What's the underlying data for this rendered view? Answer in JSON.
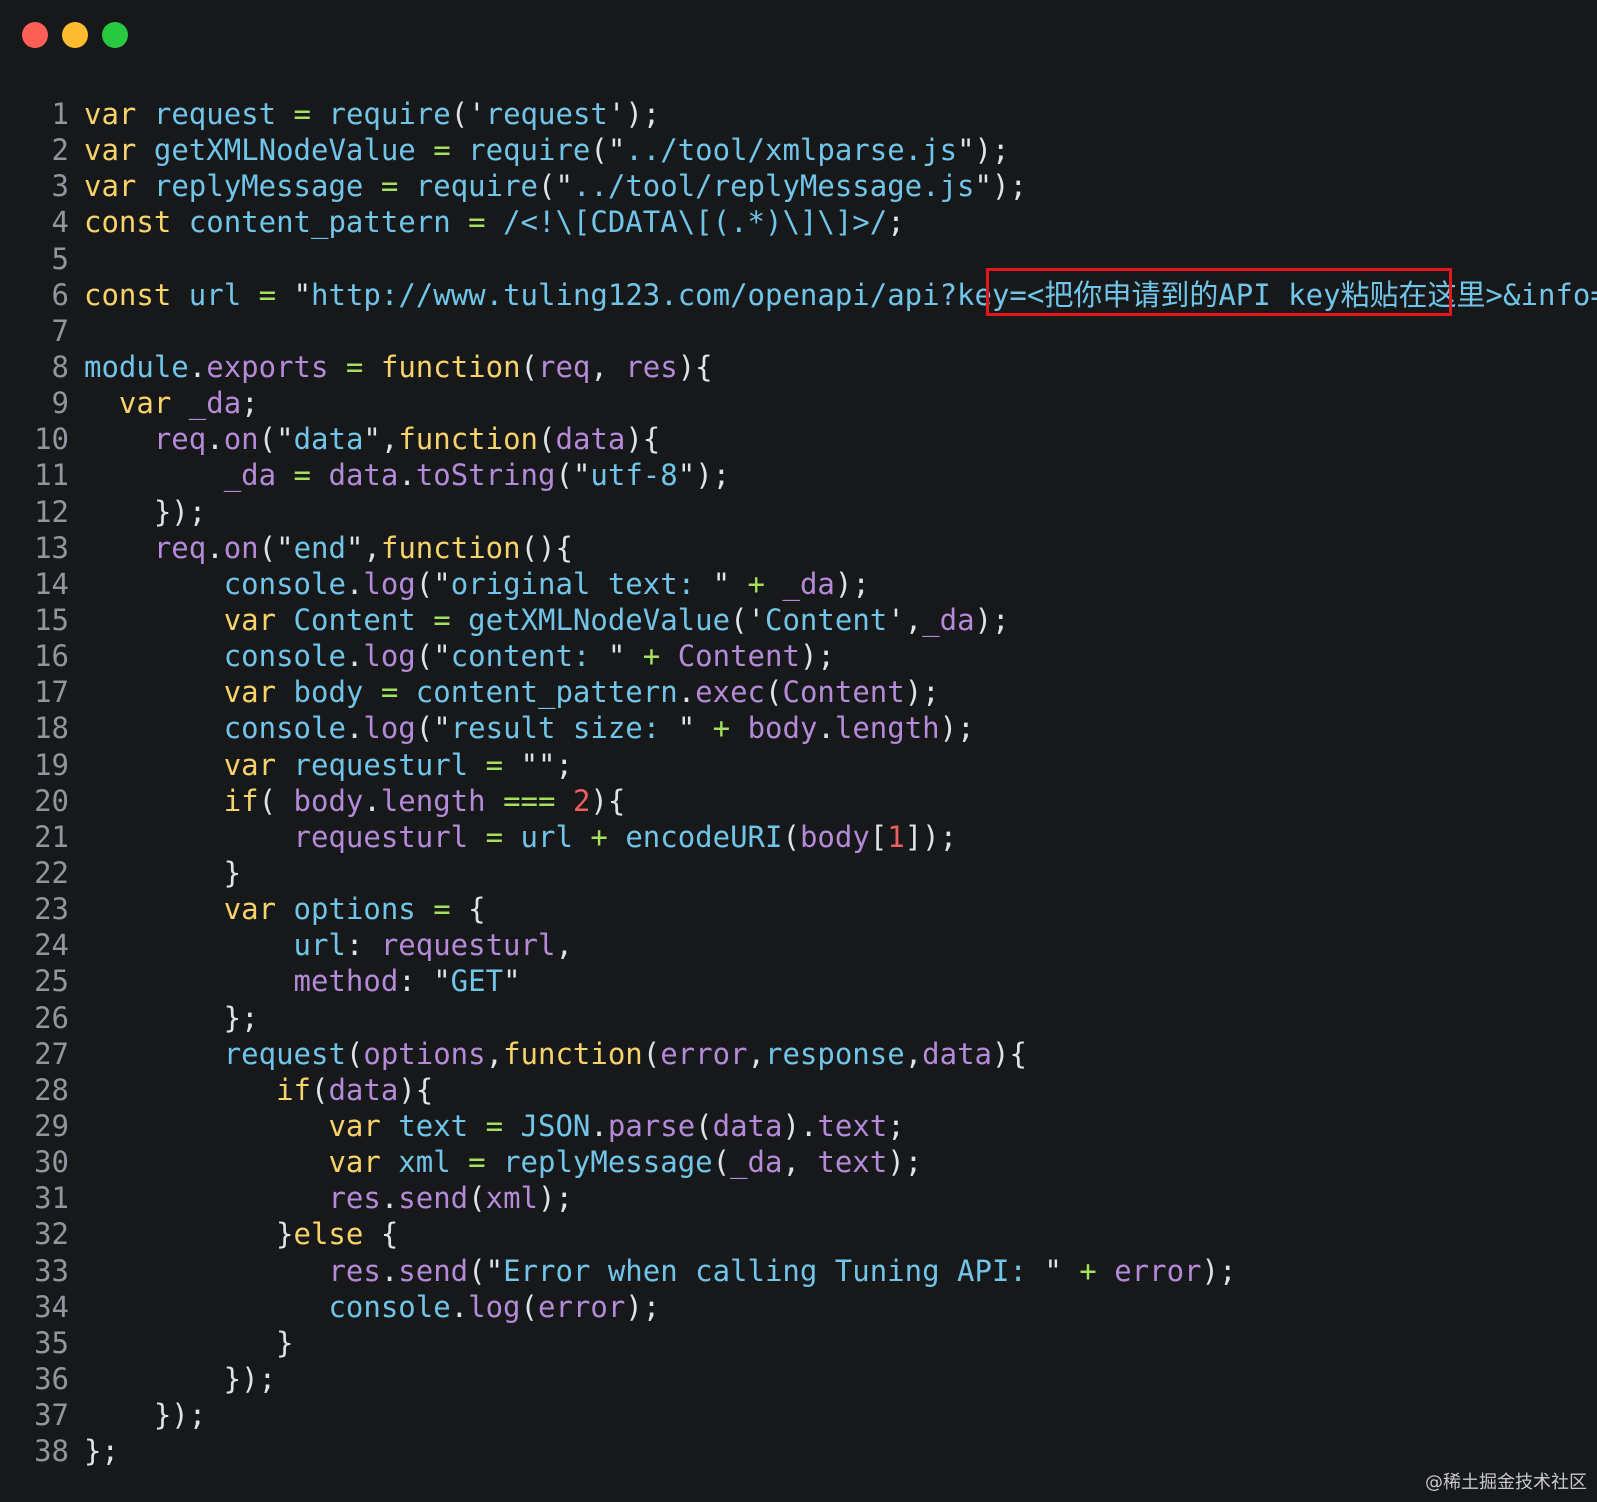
{
  "window": {
    "buttons": [
      "close",
      "minimize",
      "zoom"
    ]
  },
  "code_lines": [
    {
      "n": "1",
      "code": [
        [
          "kw",
          "var"
        ],
        [
          "pu",
          " "
        ],
        [
          "id",
          "request"
        ],
        [
          "pu",
          " "
        ],
        [
          "op",
          "="
        ],
        [
          "pu",
          " "
        ],
        [
          "id",
          "require"
        ],
        [
          "pu",
          "("
        ],
        [
          "st",
          "'"
        ],
        [
          "sv",
          "request"
        ],
        [
          "st",
          "'"
        ],
        [
          "pu",
          ");"
        ]
      ]
    },
    {
      "n": "2",
      "code": [
        [
          "kw",
          "var"
        ],
        [
          "pu",
          " "
        ],
        [
          "id",
          "getXMLNodeValue"
        ],
        [
          "pu",
          " "
        ],
        [
          "op",
          "="
        ],
        [
          "pu",
          " "
        ],
        [
          "id",
          "require"
        ],
        [
          "pu",
          "("
        ],
        [
          "st",
          "\""
        ],
        [
          "sv",
          "../tool/xmlparse.js"
        ],
        [
          "st",
          "\""
        ],
        [
          "pu",
          ");"
        ]
      ]
    },
    {
      "n": "3",
      "code": [
        [
          "kw",
          "var"
        ],
        [
          "pu",
          " "
        ],
        [
          "id",
          "replyMessage"
        ],
        [
          "pu",
          " "
        ],
        [
          "op",
          "="
        ],
        [
          "pu",
          " "
        ],
        [
          "id",
          "require"
        ],
        [
          "pu",
          "("
        ],
        [
          "st",
          "\""
        ],
        [
          "sv",
          "../tool/replyMessage.js"
        ],
        [
          "st",
          "\""
        ],
        [
          "pu",
          ");"
        ]
      ]
    },
    {
      "n": "4",
      "code": [
        [
          "kw",
          "const"
        ],
        [
          "pu",
          " "
        ],
        [
          "id",
          "content_pattern"
        ],
        [
          "pu",
          " "
        ],
        [
          "op",
          "="
        ],
        [
          "pu",
          " "
        ],
        [
          "sv",
          "/<!\\[CDATA\\[(.*)\\]\\]>/"
        ],
        [
          "pu",
          ";"
        ]
      ]
    },
    {
      "n": "5",
      "code": []
    },
    {
      "n": "6",
      "code": [
        [
          "kw",
          "const"
        ],
        [
          "pu",
          " "
        ],
        [
          "id",
          "url"
        ],
        [
          "pu",
          " "
        ],
        [
          "op",
          "="
        ],
        [
          "pu",
          " "
        ],
        [
          "st",
          "\""
        ],
        [
          "sv",
          "http://www.tuling123.com/openapi/api?key=<把你申请到的API key粘贴在这里>&info="
        ],
        [
          "st",
          "\""
        ],
        [
          "pu",
          ";"
        ]
      ]
    },
    {
      "n": "7",
      "code": []
    },
    {
      "n": "8",
      "code": [
        [
          "id",
          "module"
        ],
        [
          "pu",
          "."
        ],
        [
          "pr",
          "exports"
        ],
        [
          "pu",
          " "
        ],
        [
          "op",
          "="
        ],
        [
          "pu",
          " "
        ],
        [
          "kw",
          "function"
        ],
        [
          "pu",
          "("
        ],
        [
          "pr",
          "req"
        ],
        [
          "pu",
          ", "
        ],
        [
          "pr",
          "res"
        ],
        [
          "pu",
          "){"
        ]
      ]
    },
    {
      "n": "9",
      "code": [
        [
          "pu",
          "  "
        ],
        [
          "kw",
          "var"
        ],
        [
          "pu",
          " "
        ],
        [
          "pr",
          "_da"
        ],
        [
          "pu",
          ";"
        ]
      ]
    },
    {
      "n": "10",
      "code": [
        [
          "pu",
          "    "
        ],
        [
          "pr",
          "req"
        ],
        [
          "pu",
          "."
        ],
        [
          "pr",
          "on"
        ],
        [
          "pu",
          "("
        ],
        [
          "st",
          "\""
        ],
        [
          "sv",
          "data"
        ],
        [
          "st",
          "\""
        ],
        [
          "pu",
          ","
        ],
        [
          "kw",
          "function"
        ],
        [
          "pu",
          "("
        ],
        [
          "pr",
          "data"
        ],
        [
          "pu",
          "){"
        ]
      ]
    },
    {
      "n": "11",
      "code": [
        [
          "pu",
          "        "
        ],
        [
          "pr",
          "_da"
        ],
        [
          "pu",
          " "
        ],
        [
          "op",
          "="
        ],
        [
          "pu",
          " "
        ],
        [
          "pr",
          "data"
        ],
        [
          "pu",
          "."
        ],
        [
          "pr",
          "toString"
        ],
        [
          "pu",
          "("
        ],
        [
          "st",
          "\""
        ],
        [
          "sv",
          "utf-8"
        ],
        [
          "st",
          "\""
        ],
        [
          "pu",
          ");"
        ]
      ]
    },
    {
      "n": "12",
      "code": [
        [
          "pu",
          "    });"
        ]
      ]
    },
    {
      "n": "13",
      "code": [
        [
          "pu",
          "    "
        ],
        [
          "pr",
          "req"
        ],
        [
          "pu",
          "."
        ],
        [
          "pr",
          "on"
        ],
        [
          "pu",
          "("
        ],
        [
          "st",
          "\""
        ],
        [
          "sv",
          "end"
        ],
        [
          "st",
          "\""
        ],
        [
          "pu",
          ","
        ],
        [
          "kw",
          "function"
        ],
        [
          "pu",
          "(){"
        ]
      ]
    },
    {
      "n": "14",
      "code": [
        [
          "pu",
          "        "
        ],
        [
          "id",
          "console"
        ],
        [
          "pu",
          "."
        ],
        [
          "pr",
          "log"
        ],
        [
          "pu",
          "("
        ],
        [
          "st",
          "\""
        ],
        [
          "sv",
          "original text: "
        ],
        [
          "st",
          "\""
        ],
        [
          "pu",
          " "
        ],
        [
          "op",
          "+"
        ],
        [
          "pu",
          " "
        ],
        [
          "pr",
          "_da"
        ],
        [
          "pu",
          ");"
        ]
      ]
    },
    {
      "n": "15",
      "code": [
        [
          "pu",
          "        "
        ],
        [
          "kw",
          "var"
        ],
        [
          "pu",
          " "
        ],
        [
          "id",
          "Content"
        ],
        [
          "pu",
          " "
        ],
        [
          "op",
          "="
        ],
        [
          "pu",
          " "
        ],
        [
          "id",
          "getXMLNodeValue"
        ],
        [
          "pu",
          "("
        ],
        [
          "st",
          "'"
        ],
        [
          "sv",
          "Content"
        ],
        [
          "st",
          "'"
        ],
        [
          "pu",
          ","
        ],
        [
          "pr",
          "_da"
        ],
        [
          "pu",
          ");"
        ]
      ]
    },
    {
      "n": "16",
      "code": [
        [
          "pu",
          "        "
        ],
        [
          "id",
          "console"
        ],
        [
          "pu",
          "."
        ],
        [
          "pr",
          "log"
        ],
        [
          "pu",
          "("
        ],
        [
          "st",
          "\""
        ],
        [
          "sv",
          "content: "
        ],
        [
          "st",
          "\""
        ],
        [
          "pu",
          " "
        ],
        [
          "op",
          "+"
        ],
        [
          "pu",
          " "
        ],
        [
          "pr",
          "Content"
        ],
        [
          "pu",
          ");"
        ]
      ]
    },
    {
      "n": "17",
      "code": [
        [
          "pu",
          "        "
        ],
        [
          "kw",
          "var"
        ],
        [
          "pu",
          " "
        ],
        [
          "id",
          "body"
        ],
        [
          "pu",
          " "
        ],
        [
          "op",
          "="
        ],
        [
          "pu",
          " "
        ],
        [
          "id",
          "content_pattern"
        ],
        [
          "pu",
          "."
        ],
        [
          "pr",
          "exec"
        ],
        [
          "pu",
          "("
        ],
        [
          "pr",
          "Content"
        ],
        [
          "pu",
          ");"
        ]
      ]
    },
    {
      "n": "18",
      "code": [
        [
          "pu",
          "        "
        ],
        [
          "id",
          "console"
        ],
        [
          "pu",
          "."
        ],
        [
          "pr",
          "log"
        ],
        [
          "pu",
          "("
        ],
        [
          "st",
          "\""
        ],
        [
          "sv",
          "result size: "
        ],
        [
          "st",
          "\""
        ],
        [
          "pu",
          " "
        ],
        [
          "op",
          "+"
        ],
        [
          "pu",
          " "
        ],
        [
          "pr",
          "body"
        ],
        [
          "pu",
          "."
        ],
        [
          "pr",
          "length"
        ],
        [
          "pu",
          ");"
        ]
      ]
    },
    {
      "n": "19",
      "code": [
        [
          "pu",
          "        "
        ],
        [
          "kw",
          "var"
        ],
        [
          "pu",
          " "
        ],
        [
          "id",
          "requesturl"
        ],
        [
          "pu",
          " "
        ],
        [
          "op",
          "="
        ],
        [
          "pu",
          " "
        ],
        [
          "st",
          "\"\""
        ],
        [
          "pu",
          ";"
        ]
      ]
    },
    {
      "n": "20",
      "code": [
        [
          "pu",
          "        "
        ],
        [
          "kw",
          "if"
        ],
        [
          "pu",
          "( "
        ],
        [
          "pr",
          "body"
        ],
        [
          "pu",
          "."
        ],
        [
          "pr",
          "length"
        ],
        [
          "pu",
          " "
        ],
        [
          "op",
          "==="
        ],
        [
          "pu",
          " "
        ],
        [
          "nu",
          "2"
        ],
        [
          "pu",
          "){"
        ]
      ]
    },
    {
      "n": "21",
      "code": [
        [
          "pu",
          "            "
        ],
        [
          "pr",
          "requesturl"
        ],
        [
          "pu",
          " "
        ],
        [
          "op",
          "="
        ],
        [
          "pu",
          " "
        ],
        [
          "id",
          "url"
        ],
        [
          "pu",
          " "
        ],
        [
          "op",
          "+"
        ],
        [
          "pu",
          " "
        ],
        [
          "id",
          "encodeURI"
        ],
        [
          "pu",
          "("
        ],
        [
          "pr",
          "body"
        ],
        [
          "pu",
          "["
        ],
        [
          "nu",
          "1"
        ],
        [
          "pu",
          "]);"
        ]
      ]
    },
    {
      "n": "22",
      "code": [
        [
          "pu",
          "        }"
        ]
      ]
    },
    {
      "n": "23",
      "code": [
        [
          "pu",
          "        "
        ],
        [
          "kw",
          "var"
        ],
        [
          "pu",
          " "
        ],
        [
          "id",
          "options"
        ],
        [
          "pu",
          " "
        ],
        [
          "op",
          "="
        ],
        [
          "pu",
          " {"
        ]
      ]
    },
    {
      "n": "24",
      "code": [
        [
          "pu",
          "            "
        ],
        [
          "id",
          "url"
        ],
        [
          "pu",
          ": "
        ],
        [
          "pr",
          "requesturl"
        ],
        [
          "pu",
          ","
        ]
      ]
    },
    {
      "n": "25",
      "code": [
        [
          "pu",
          "            "
        ],
        [
          "pr",
          "method"
        ],
        [
          "pu",
          ": "
        ],
        [
          "st",
          "\""
        ],
        [
          "sv",
          "GET"
        ],
        [
          "st",
          "\""
        ]
      ]
    },
    {
      "n": "26",
      "code": [
        [
          "pu",
          "        };"
        ]
      ]
    },
    {
      "n": "27",
      "code": [
        [
          "pu",
          "        "
        ],
        [
          "id",
          "request"
        ],
        [
          "pu",
          "("
        ],
        [
          "pr",
          "options"
        ],
        [
          "pu",
          ","
        ],
        [
          "kw",
          "function"
        ],
        [
          "pu",
          "("
        ],
        [
          "pr",
          "error"
        ],
        [
          "pu",
          ","
        ],
        [
          "id",
          "response"
        ],
        [
          "pu",
          ","
        ],
        [
          "pr",
          "data"
        ],
        [
          "pu",
          "){"
        ]
      ]
    },
    {
      "n": "28",
      "code": [
        [
          "pu",
          "           "
        ],
        [
          "kw",
          "if"
        ],
        [
          "pu",
          "("
        ],
        [
          "pr",
          "data"
        ],
        [
          "pu",
          "){"
        ]
      ]
    },
    {
      "n": "29",
      "code": [
        [
          "pu",
          "              "
        ],
        [
          "kw",
          "var"
        ],
        [
          "pu",
          " "
        ],
        [
          "id",
          "text"
        ],
        [
          "pu",
          " "
        ],
        [
          "op",
          "="
        ],
        [
          "pu",
          " "
        ],
        [
          "id",
          "JSON"
        ],
        [
          "pu",
          "."
        ],
        [
          "pr",
          "parse"
        ],
        [
          "pu",
          "("
        ],
        [
          "pr",
          "data"
        ],
        [
          "pu",
          ")."
        ],
        [
          "pr",
          "text"
        ],
        [
          "pu",
          ";"
        ]
      ]
    },
    {
      "n": "30",
      "code": [
        [
          "pu",
          "              "
        ],
        [
          "kw",
          "var"
        ],
        [
          "pu",
          " "
        ],
        [
          "id",
          "xml"
        ],
        [
          "pu",
          " "
        ],
        [
          "op",
          "="
        ],
        [
          "pu",
          " "
        ],
        [
          "id",
          "replyMessage"
        ],
        [
          "pu",
          "("
        ],
        [
          "pr",
          "_da"
        ],
        [
          "pu",
          ", "
        ],
        [
          "pr",
          "text"
        ],
        [
          "pu",
          ");"
        ]
      ]
    },
    {
      "n": "31",
      "code": [
        [
          "pu",
          "              "
        ],
        [
          "pr",
          "res"
        ],
        [
          "pu",
          "."
        ],
        [
          "pr",
          "send"
        ],
        [
          "pu",
          "("
        ],
        [
          "pr",
          "xml"
        ],
        [
          "pu",
          ");"
        ]
      ]
    },
    {
      "n": "32",
      "code": [
        [
          "pu",
          "           }"
        ],
        [
          "kw",
          "else"
        ],
        [
          "pu",
          " {"
        ]
      ]
    },
    {
      "n": "33",
      "code": [
        [
          "pu",
          "              "
        ],
        [
          "pr",
          "res"
        ],
        [
          "pu",
          "."
        ],
        [
          "pr",
          "send"
        ],
        [
          "pu",
          "("
        ],
        [
          "st",
          "\""
        ],
        [
          "sv",
          "Error when calling Tuning API: "
        ],
        [
          "st",
          "\""
        ],
        [
          "pu",
          " "
        ],
        [
          "op",
          "+"
        ],
        [
          "pu",
          " "
        ],
        [
          "pr",
          "error"
        ],
        [
          "pu",
          ");"
        ]
      ]
    },
    {
      "n": "34",
      "code": [
        [
          "pu",
          "              "
        ],
        [
          "id",
          "console"
        ],
        [
          "pu",
          "."
        ],
        [
          "pr",
          "log"
        ],
        [
          "pu",
          "("
        ],
        [
          "pr",
          "error"
        ],
        [
          "pu",
          ");"
        ]
      ]
    },
    {
      "n": "35",
      "code": [
        [
          "pu",
          "           }"
        ]
      ]
    },
    {
      "n": "36",
      "code": [
        [
          "pu",
          "        });"
        ]
      ]
    },
    {
      "n": "37",
      "code": [
        [
          "pu",
          "    });"
        ]
      ]
    },
    {
      "n": "38",
      "code": [
        [
          "pu",
          "};"
        ]
      ]
    }
  ],
  "highlight": {
    "line": "6",
    "text": "<把你申请到的API key粘贴在这里>",
    "color": "#e3171c"
  },
  "watermark": "@稀土掘金技术社区",
  "colors": {
    "background": "#17181a",
    "keyword": "#f8d36a",
    "identifier": "#70c5e9",
    "property": "#b58ad8",
    "number": "#ef5f5f",
    "operator": "#a3e15e",
    "line_number": "#8f969d"
  }
}
